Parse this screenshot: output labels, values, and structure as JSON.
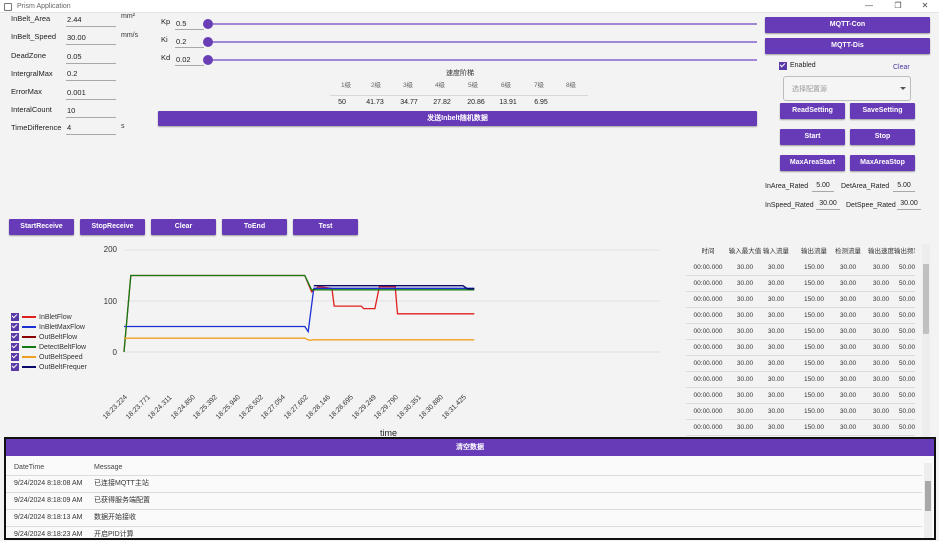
{
  "window": {
    "title": "Prism Application",
    "buttons": {
      "minimize": "—",
      "maximize": "❐",
      "close": "✕"
    }
  },
  "params": [
    {
      "label": "InBelt_Area",
      "value": "2.44",
      "unit": "mm²"
    },
    {
      "label": "InBelt_Speed",
      "value": "30.00",
      "unit": "mm/s"
    },
    {
      "label": "DeadZone",
      "value": "0.05",
      "unit": ""
    },
    {
      "label": "IntergralMax",
      "value": "0.2",
      "unit": ""
    },
    {
      "label": "ErrorMax",
      "value": "0.001",
      "unit": ""
    },
    {
      "label": "InteralCount",
      "value": "10",
      "unit": ""
    },
    {
      "label": "TimeDifference",
      "value": "4",
      "unit": "s"
    }
  ],
  "pid": [
    {
      "label": "Kp",
      "value": "0.5",
      "level": 0.0
    },
    {
      "label": "Ki",
      "value": "0.2",
      "level": 0.0
    },
    {
      "label": "Kd",
      "value": "0.02",
      "level": 0.0
    }
  ],
  "speed_table": {
    "title": "速度阶梯",
    "levels": [
      "1级",
      "2级",
      "3级",
      "4级",
      "5级",
      "6级",
      "7级",
      "8级"
    ],
    "values": [
      "50",
      "41.73",
      "34.77",
      "27.82",
      "20.86",
      "13.91",
      "6.95",
      ""
    ]
  },
  "send_button": "发送Inbelt随机数据",
  "mqtt": {
    "connect": "MQTT-Con",
    "disconnect": "MQTT-Dis"
  },
  "config": {
    "enabled_label": "Enabled",
    "enabled": true,
    "clear": "Clear",
    "select_placeholder": "选择配置源"
  },
  "settings_buttons": {
    "read": "ReadSetting",
    "save": "SaveSetting",
    "start": "Start",
    "stop": "Stop",
    "max_start": "MaxAreaStart",
    "max_stop": "MaxAreaStop"
  },
  "rated": {
    "in_area_label": "InArea_Rated",
    "in_area": "5.00",
    "det_area_label": "DetArea_Rated",
    "det_area": "5.00",
    "in_speed_label": "InSpeed_Rated",
    "in_speed": "30.00",
    "det_speed_label": "DetSpee_Rated",
    "det_speed": "30.00"
  },
  "actions": {
    "start_receive": "StartReceive",
    "stop_receive": "StopReceive",
    "clear": "Clear",
    "to_end": "ToEnd",
    "test": "Test"
  },
  "legend": [
    {
      "name": "InBletFlow",
      "color": "#e0201c"
    },
    {
      "name": "InBletMaxFlow",
      "color": "#1a2fd4"
    },
    {
      "name": "OutBeltFlow",
      "color": "#8b0000"
    },
    {
      "name": "DetectBeltFlow",
      "color": "#137a13"
    },
    {
      "name": "OutBeltSpeed",
      "color": "#f0a020"
    },
    {
      "name": "OutBeltFrequer",
      "color": "#0a0a6a"
    }
  ],
  "chart_data": {
    "type": "line",
    "xlabel": "time",
    "ylim": [
      0,
      200
    ],
    "yticks": [
      "200",
      "100",
      "0"
    ],
    "xticks": [
      "18:23.224",
      "18:23.771",
      "18:24.311",
      "18:24.850",
      "18:25.392",
      "18:25.940",
      "18:26.502",
      "18:27.054",
      "18:27.602",
      "18:28.146",
      "18:28.695",
      "18:29.249",
      "18:29.790",
      "18:30.351",
      "18:30.880",
      "18:31.425"
    ],
    "series": [
      {
        "name": "InBletFlow",
        "color": "#e0201c",
        "points": [
          [
            0,
            0
          ],
          [
            0.3,
            150
          ],
          [
            8,
            150
          ],
          [
            8.3,
            118
          ],
          [
            8.6,
            128
          ],
          [
            9.2,
            125
          ],
          [
            9.3,
            90
          ],
          [
            10.5,
            90
          ],
          [
            10.6,
            85
          ],
          [
            11.1,
            85
          ],
          [
            11.3,
            128
          ],
          [
            12,
            128
          ],
          [
            12.1,
            75
          ],
          [
            15.5,
            75
          ]
        ]
      },
      {
        "name": "InBletMaxFlow",
        "color": "#1a2fd4",
        "points": [
          [
            0,
            50
          ],
          [
            8,
            50
          ],
          [
            8.15,
            40
          ],
          [
            8.4,
            125
          ],
          [
            15.5,
            125
          ]
        ]
      },
      {
        "name": "DetectBeltFlow",
        "color": "#137a13",
        "points": [
          [
            0,
            0
          ],
          [
            0.3,
            150
          ],
          [
            8,
            150
          ],
          [
            8.3,
            122
          ],
          [
            15.3,
            122
          ],
          [
            15.5,
            122
          ]
        ]
      },
      {
        "name": "OutBeltSpeed",
        "color": "#f0a020",
        "points": [
          [
            0,
            27
          ],
          [
            8,
            27
          ],
          [
            8.2,
            23
          ],
          [
            8.4,
            24
          ],
          [
            15.5,
            24
          ]
        ]
      },
      {
        "name": "OutBeltFrequer",
        "color": "#0a0a6a",
        "points": [
          [
            8.4,
            130
          ],
          [
            15,
            130
          ],
          [
            15.2,
            124
          ],
          [
            15.5,
            124
          ]
        ]
      }
    ]
  },
  "table": {
    "headers": [
      "时间",
      "输入最大值",
      "输入流量",
      "输出流量",
      "检测流量",
      "输出速度",
      "输出频率"
    ],
    "rows": [
      [
        "00:00.000",
        "30.00",
        "30.00",
        "150.00",
        "30.00",
        "30.00",
        "50.00"
      ],
      [
        "00:00.000",
        "30.00",
        "30.00",
        "150.00",
        "30.00",
        "30.00",
        "50.00"
      ],
      [
        "00:00.000",
        "30.00",
        "30.00",
        "150.00",
        "30.00",
        "30.00",
        "50.00"
      ],
      [
        "00:00.000",
        "30.00",
        "30.00",
        "150.00",
        "30.00",
        "30.00",
        "50.00"
      ],
      [
        "00:00.000",
        "30.00",
        "30.00",
        "150.00",
        "30.00",
        "30.00",
        "50.00"
      ],
      [
        "00:00.000",
        "30.00",
        "30.00",
        "150.00",
        "30.00",
        "30.00",
        "50.00"
      ],
      [
        "00:00.000",
        "30.00",
        "30.00",
        "150.00",
        "30.00",
        "30.00",
        "50.00"
      ],
      [
        "00:00.000",
        "30.00",
        "30.00",
        "150.00",
        "30.00",
        "30.00",
        "50.00"
      ],
      [
        "00:00.000",
        "30.00",
        "30.00",
        "150.00",
        "30.00",
        "30.00",
        "50.00"
      ],
      [
        "00:00.000",
        "30.00",
        "30.00",
        "150.00",
        "30.00",
        "30.00",
        "50.00"
      ],
      [
        "00:00.000",
        "30.00",
        "30.00",
        "150.00",
        "30.00",
        "30.00",
        "50.00"
      ]
    ]
  },
  "log": {
    "title": "清空数据",
    "headers": [
      "DateTime",
      "Message"
    ],
    "rows": [
      [
        "9/24/2024 8:18:08 AM",
        "已连接MQTT主站"
      ],
      [
        "9/24/2024 8:18:09 AM",
        "已获得服务端配置"
      ],
      [
        "9/24/2024 8:18:13 AM",
        "数据开始接收"
      ],
      [
        "9/24/2024 8:18:23 AM",
        "开启PID计算"
      ]
    ]
  }
}
